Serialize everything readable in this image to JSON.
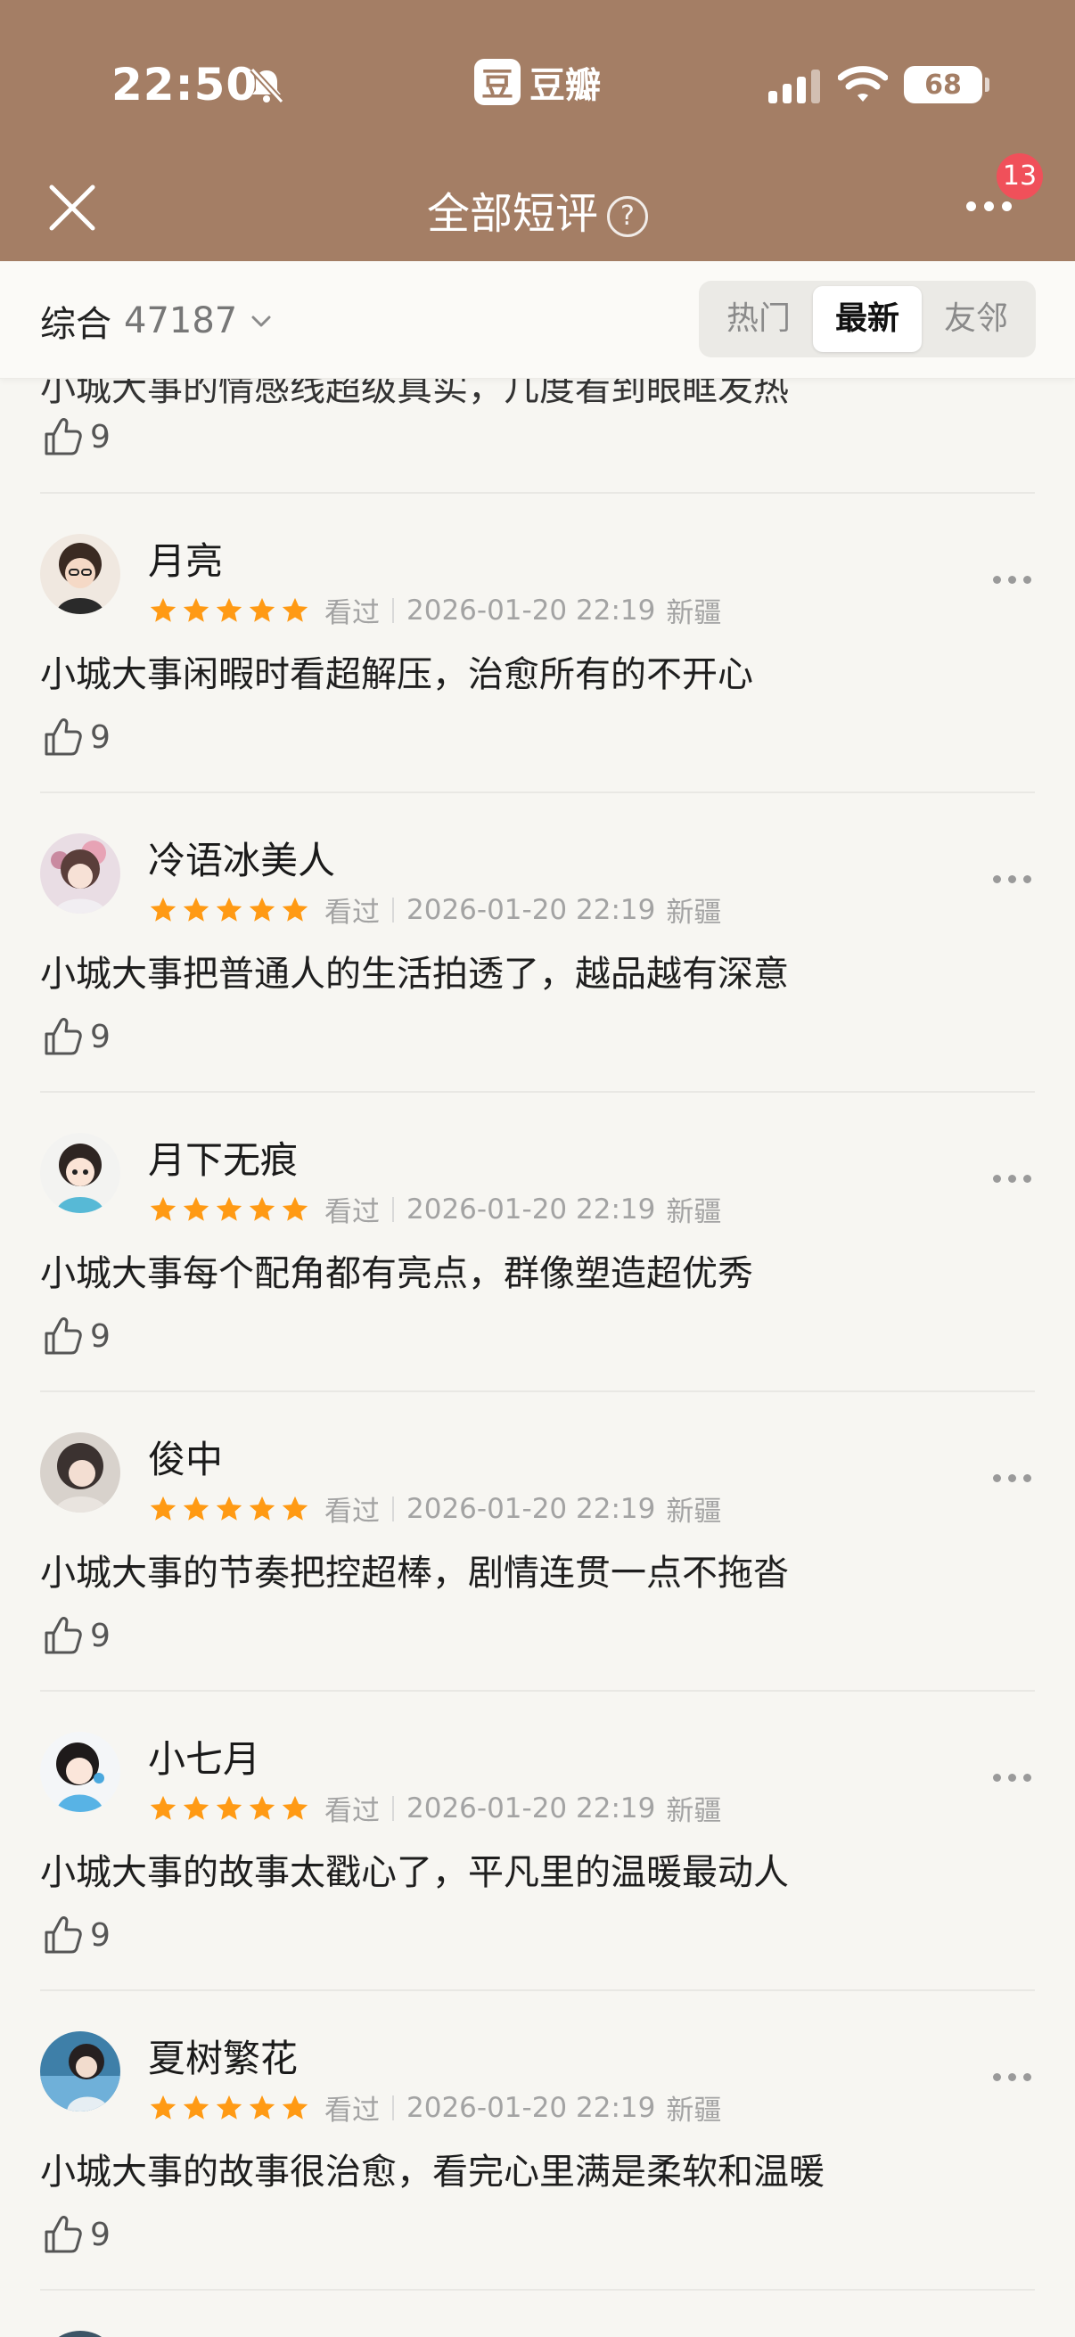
{
  "status_bar": {
    "time": "22:50",
    "app_name": "豆瓣",
    "app_logo_char": "豆",
    "battery": "68"
  },
  "header": {
    "title": "全部短评",
    "help_symbol": "?",
    "notification_count": "13",
    "bg_color": "#a47e65"
  },
  "filter": {
    "sort_label": "综合",
    "total_count": "47187",
    "tabs": [
      "热门",
      "最新",
      "友邻"
    ],
    "active_tab": "最新"
  },
  "partial_review": {
    "content": "小城大事的情感线超级真实，几度看到眼眶发热",
    "likes": "9"
  },
  "reviews": [
    {
      "user": "月亮",
      "status": "看过",
      "date": "2026-01-20 22:19",
      "location": "新疆",
      "content": "小城大事闲暇时看超解压，治愈所有的不开心",
      "likes": "9"
    },
    {
      "user": "冷语冰美人",
      "status": "看过",
      "date": "2026-01-20 22:19",
      "location": "新疆",
      "content": "小城大事把普通人的生活拍透了，越品越有深意",
      "likes": "9"
    },
    {
      "user": "月下无痕",
      "status": "看过",
      "date": "2026-01-20 22:19",
      "location": "新疆",
      "content": "小城大事每个配角都有亮点，群像塑造超优秀",
      "likes": "9"
    },
    {
      "user": "俊中",
      "status": "看过",
      "date": "2026-01-20 22:19",
      "location": "新疆",
      "content": "小城大事的节奏把控超棒，剧情连贯一点不拖沓",
      "likes": "9"
    },
    {
      "user": "小七月",
      "status": "看过",
      "date": "2026-01-20 22:19",
      "location": "新疆",
      "content": "小城大事的故事太戳心了，平凡里的温暖最动人",
      "likes": "9"
    },
    {
      "user": "夏树繁花",
      "status": "看过",
      "date": "2026-01-20 22:19",
      "location": "新疆",
      "content": "小城大事的故事很治愈，看完心里满是柔软和温暖",
      "likes": "9"
    }
  ],
  "rating_stars": 5,
  "colors": {
    "star": "#ff9a14",
    "badge": "#f0505a"
  }
}
